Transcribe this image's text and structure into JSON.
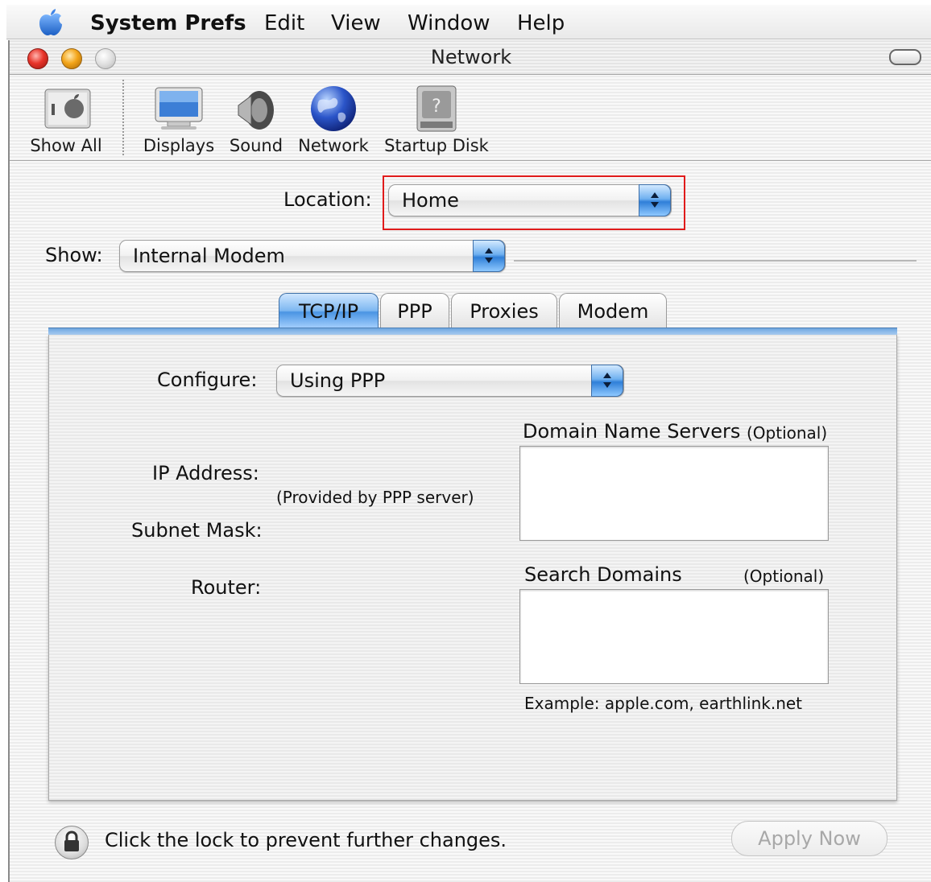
{
  "menubar": {
    "app_name": "System Prefs",
    "items": [
      "Edit",
      "View",
      "Window",
      "Help"
    ]
  },
  "window": {
    "title": "Network"
  },
  "toolbar": {
    "items": [
      {
        "label": "Show All",
        "icon": "show-all-icon"
      },
      {
        "label": "Displays",
        "icon": "display-icon"
      },
      {
        "label": "Sound",
        "icon": "speaker-icon"
      },
      {
        "label": "Network",
        "icon": "globe-icon"
      },
      {
        "label": "Startup Disk",
        "icon": "disk-icon"
      }
    ]
  },
  "location": {
    "label": "Location:",
    "value": "Home"
  },
  "show": {
    "label": "Show:",
    "value": "Internal Modem"
  },
  "tabs": [
    {
      "label": "TCP/IP",
      "active": true
    },
    {
      "label": "PPP",
      "active": false
    },
    {
      "label": "Proxies",
      "active": false
    },
    {
      "label": "Modem",
      "active": false
    }
  ],
  "tcpip": {
    "configure_label": "Configure:",
    "configure_value": "Using PPP",
    "ip_label": "IP Address:",
    "provided_note": "(Provided by PPP server)",
    "subnet_label": "Subnet Mask:",
    "router_label": "Router:",
    "dns_label": "Domain Name Servers",
    "dns_optional": "(Optional)",
    "dns_value": "",
    "search_label": "Search Domains",
    "search_optional": "(Optional)",
    "search_value": "",
    "example": "Example: apple.com, earthlink.net"
  },
  "footer": {
    "lock_text": "Click the lock to prevent further changes.",
    "apply_label": "Apply Now"
  },
  "colors": {
    "accent_blue": "#4a94e3",
    "highlight_red": "#e01b1b"
  }
}
